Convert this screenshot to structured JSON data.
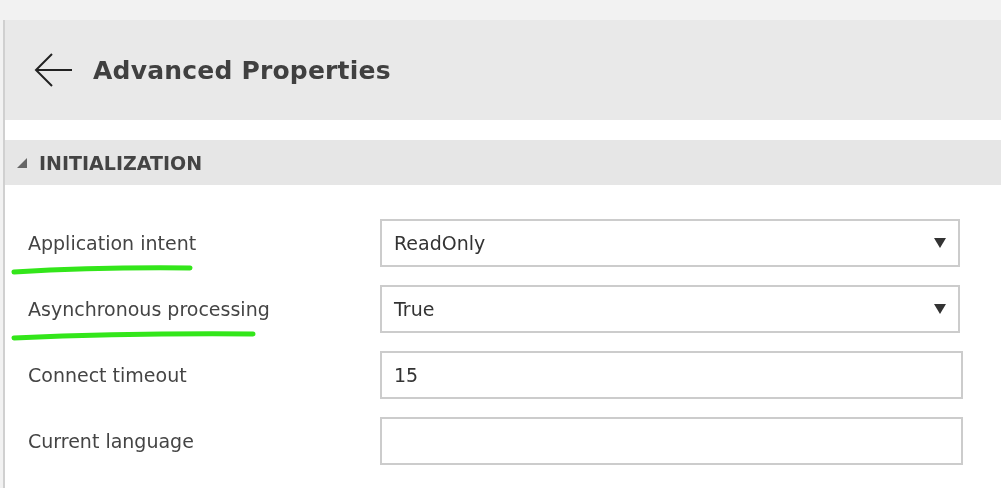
{
  "header": {
    "title": "Advanced Properties"
  },
  "section": {
    "title": "INITIALIZATION",
    "expanded": true
  },
  "properties": [
    {
      "label": "Application intent",
      "kind": "dropdown",
      "value": "ReadOnly",
      "highlighted": true
    },
    {
      "label": "Asynchronous processing",
      "kind": "dropdown",
      "value": "True",
      "highlighted": true
    },
    {
      "label": "Connect timeout",
      "kind": "text",
      "value": "15",
      "highlighted": false
    },
    {
      "label": "Current language",
      "kind": "text",
      "highlighted": false
    }
  ]
}
